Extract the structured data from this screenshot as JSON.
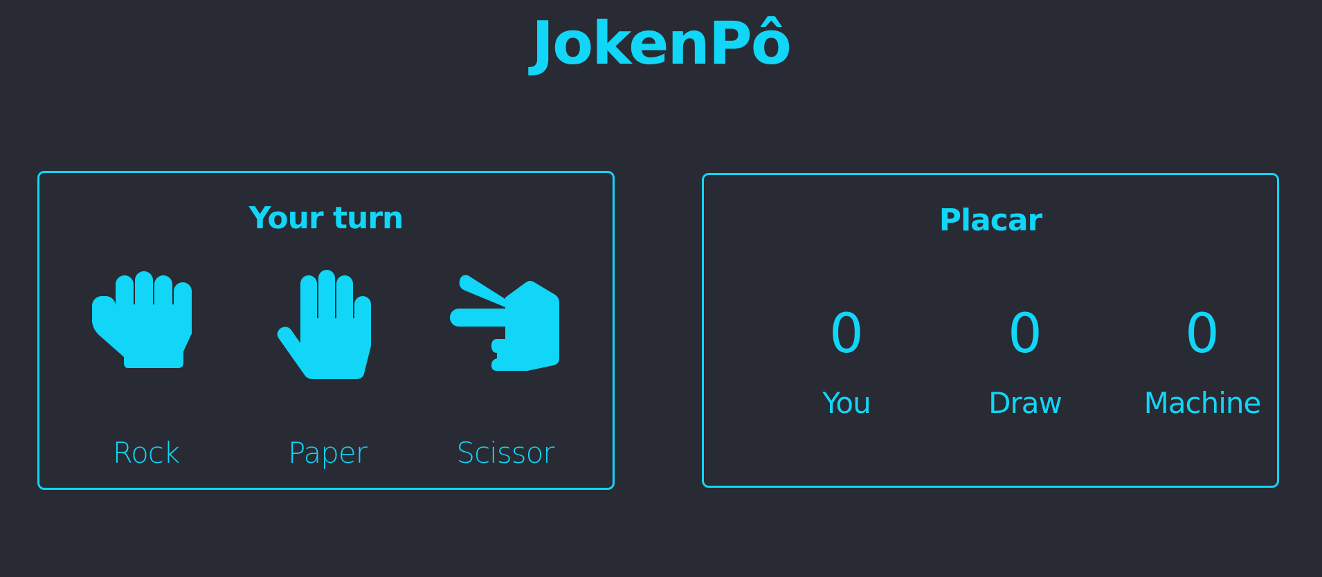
{
  "title": "JokenPô",
  "colors": {
    "background": "#282b34",
    "accent": "#11d6f7"
  },
  "turn_panel": {
    "heading": "Your turn",
    "choices": [
      {
        "label": "Rock",
        "icon": "fist-hand-icon"
      },
      {
        "label": "Paper",
        "icon": "open-hand-icon"
      },
      {
        "label": "Scissor",
        "icon": "pointing-hand-icon"
      }
    ]
  },
  "score_panel": {
    "heading": "Placar",
    "scores": [
      {
        "label": "You",
        "value": "0"
      },
      {
        "label": "Draw",
        "value": "0"
      },
      {
        "label": "Machine",
        "value": "0"
      }
    ]
  }
}
